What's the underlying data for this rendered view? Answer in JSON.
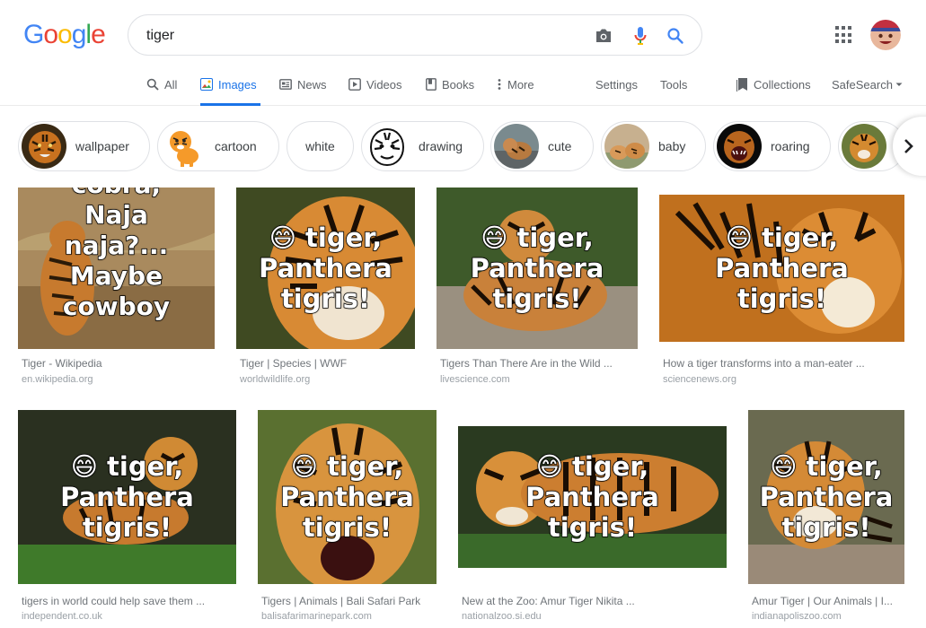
{
  "logo": {
    "letters": [
      "G",
      "o",
      "o",
      "g",
      "l",
      "e"
    ],
    "colors": [
      "#4285F4",
      "#EA4335",
      "#FBBC05",
      "#4285F4",
      "#34A853",
      "#EA4335"
    ]
  },
  "search": {
    "query": "tiger",
    "icons": [
      "camera-icon",
      "microphone-icon",
      "search-icon"
    ]
  },
  "accent": "#1a73e8",
  "nav": {
    "tabs": [
      {
        "label": "All",
        "icon": "search-icon"
      },
      {
        "label": "Images",
        "icon": "image-icon",
        "active": true
      },
      {
        "label": "News",
        "icon": "news-icon"
      },
      {
        "label": "Videos",
        "icon": "play-icon"
      },
      {
        "label": "Books",
        "icon": "book-icon"
      },
      {
        "label": "More",
        "icon": "kebab-icon"
      }
    ],
    "settings": "Settings",
    "tools": "Tools",
    "collections": "Collections",
    "safesearch": "SafeSearch"
  },
  "chips": [
    "wallpaper",
    "cartoon",
    "white",
    "drawing",
    "cute",
    "baby",
    "roaring"
  ],
  "results": [
    {
      "overlay": [
        "cobra,",
        "Naja",
        "naja?...",
        "Maybe",
        "cowboy"
      ],
      "title": "Tiger - Wikipedia",
      "domain": "en.wikipedia.org"
    },
    {
      "overlay": [
        "😄 tiger,",
        "Panthera",
        "tigris!"
      ],
      "title": "Tiger | Species | WWF",
      "domain": "worldwildlife.org"
    },
    {
      "overlay": [
        "😄 tiger,",
        "Panthera",
        "tigris!"
      ],
      "title": "Tigers Than There Are in the Wild ...",
      "domain": "livescience.com"
    },
    {
      "overlay": [
        "😄 tiger,",
        "Panthera",
        "tigris!"
      ],
      "title": "How a tiger transforms into a man-eater ...",
      "domain": "sciencenews.org"
    },
    {
      "overlay": [
        "😄 tiger,",
        "Panthera",
        "tigris!"
      ],
      "title": "tigers in world could help save them ...",
      "domain": "independent.co.uk"
    },
    {
      "overlay": [
        "😄 tiger,",
        "Panthera",
        "tigris!"
      ],
      "title": "Tigers | Animals | Bali Safari Park",
      "domain": "balisafarimarinepark.com"
    },
    {
      "overlay": [
        "😄 tiger,",
        "Panthera",
        "tigris!"
      ],
      "title": "New at the Zoo: Amur Tiger Nikita ...",
      "domain": "nationalzoo.si.edu"
    },
    {
      "overlay": [
        "😄 tiger,",
        "Panthera",
        "tigris!"
      ],
      "title": "Amur Tiger | Our Animals | I...",
      "domain": "indianapoliszoo.com"
    }
  ]
}
